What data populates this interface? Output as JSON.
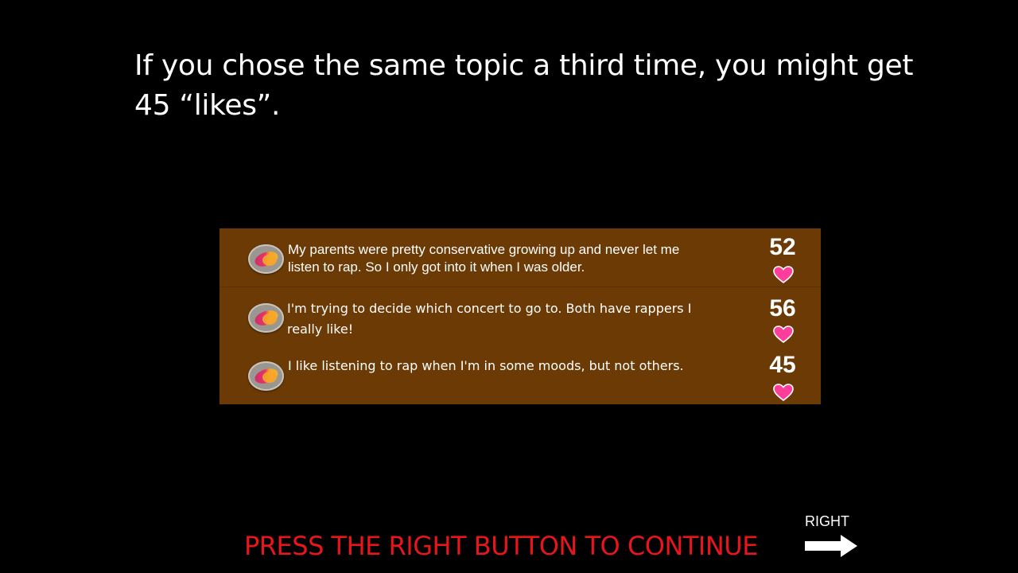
{
  "instruction": {
    "line1": "If you chose the same topic a third time, you might get",
    "line2": "45 “likes”."
  },
  "feed": {
    "background_color": "#6b3a05",
    "posts": [
      {
        "avatar_icon": "avatar-blob-icon",
        "text_line1": "My parents were pretty conservative growing up and never let me",
        "text_line2": "listen to rap. So I only got into it when I was older.",
        "likes": "52",
        "heart_icon": "heart-icon"
      },
      {
        "avatar_icon": "avatar-blob-icon",
        "text_line1": "I'm trying to decide which concert to go to. Both have rappers I",
        "text_line2": "really like!",
        "likes": "56",
        "heart_icon": "heart-icon"
      },
      {
        "avatar_icon": "avatar-blob-icon",
        "text_line1": "I like listening to rap when I'm in some moods, but not others.",
        "text_line2": "",
        "likes": "45",
        "heart_icon": "heart-icon"
      }
    ]
  },
  "footer": {
    "continue_text": "PRESS THE RIGHT BUTTON TO CONTINUE",
    "continue_color": "#e8151b",
    "right_label": "RIGHT",
    "arrow_icon": "right-arrow-icon"
  },
  "colors": {
    "background": "#000000",
    "heart": "#ff3d9a"
  }
}
